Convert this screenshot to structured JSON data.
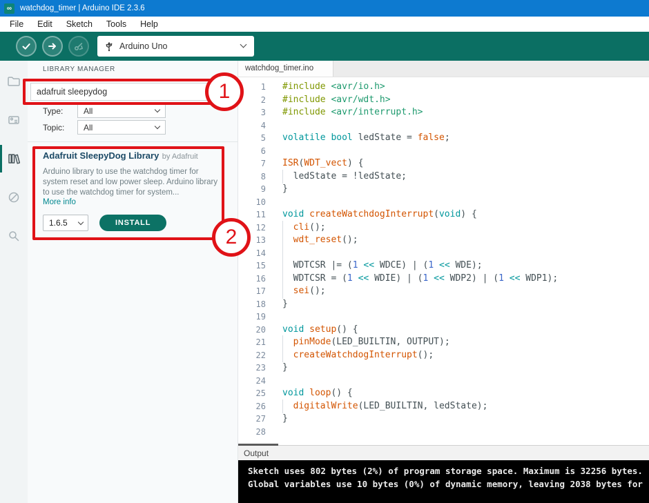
{
  "window": {
    "title": "watchdog_timer | Arduino IDE 2.3.6",
    "app_icon_glyph": "∞"
  },
  "menu": {
    "items": [
      "File",
      "Edit",
      "Sketch",
      "Tools",
      "Help"
    ]
  },
  "toolbar": {
    "buttons": [
      "verify",
      "upload",
      "start-debugging"
    ],
    "board_selected": "Arduino Uno"
  },
  "sidebar": {
    "icons": [
      "folder-sketchbook",
      "boards-manager",
      "library-manager",
      "debug-disabled",
      "search"
    ],
    "active": "library-manager"
  },
  "library_manager": {
    "title": "LIBRARY MANAGER",
    "search_value": "adafruit sleepydog",
    "type_label": "Type:",
    "type_value": "All",
    "topic_label": "Topic:",
    "topic_value": "All",
    "card": {
      "title": "Adafruit SleepyDog Library",
      "by": "by Adafruit",
      "description": "Arduino library to use the watchdog timer for system reset and low power sleep. Arduino library to use the watchdog timer for system...",
      "more_info": "More info",
      "version": "1.6.5",
      "install_label": "INSTALL"
    }
  },
  "annotations": {
    "badge1": "1",
    "badge2": "2",
    "color": "#e01217"
  },
  "editor": {
    "tab": "watchdog_timer.ino",
    "lines": [
      {
        "n": 1,
        "g": false,
        "t": [
          {
            "c": "pre",
            "s": "#include"
          },
          {
            "c": "pl",
            "s": " "
          },
          {
            "c": "inc",
            "s": "<avr/io.h>"
          }
        ]
      },
      {
        "n": 2,
        "g": false,
        "t": [
          {
            "c": "pre",
            "s": "#include"
          },
          {
            "c": "pl",
            "s": " "
          },
          {
            "c": "inc",
            "s": "<avr/wdt.h>"
          }
        ]
      },
      {
        "n": 3,
        "g": false,
        "t": [
          {
            "c": "pre",
            "s": "#include"
          },
          {
            "c": "pl",
            "s": " "
          },
          {
            "c": "inc",
            "s": "<avr/interrupt.h>"
          }
        ]
      },
      {
        "n": 4,
        "g": false,
        "t": []
      },
      {
        "n": 5,
        "g": false,
        "t": [
          {
            "c": "kw",
            "s": "volatile"
          },
          {
            "c": "pl",
            "s": " "
          },
          {
            "c": "kw",
            "s": "bool"
          },
          {
            "c": "pl",
            "s": " ledState = "
          },
          {
            "c": "lit",
            "s": "false"
          },
          {
            "c": "pl",
            "s": ";"
          }
        ]
      },
      {
        "n": 6,
        "g": false,
        "t": []
      },
      {
        "n": 7,
        "g": false,
        "t": [
          {
            "c": "fn",
            "s": "ISR"
          },
          {
            "c": "pl",
            "s": "("
          },
          {
            "c": "fn",
            "s": "WDT_vect"
          },
          {
            "c": "pl",
            "s": ") {"
          }
        ]
      },
      {
        "n": 8,
        "g": true,
        "t": [
          {
            "c": "pl",
            "s": "  ledState = !ledState;"
          }
        ]
      },
      {
        "n": 9,
        "g": false,
        "t": [
          {
            "c": "pl",
            "s": "}"
          }
        ]
      },
      {
        "n": 10,
        "g": false,
        "t": []
      },
      {
        "n": 11,
        "g": false,
        "t": [
          {
            "c": "kw",
            "s": "void"
          },
          {
            "c": "pl",
            "s": " "
          },
          {
            "c": "fn",
            "s": "createWatchdogInterrupt"
          },
          {
            "c": "pl",
            "s": "("
          },
          {
            "c": "kw",
            "s": "void"
          },
          {
            "c": "pl",
            "s": ") {"
          }
        ]
      },
      {
        "n": 12,
        "g": true,
        "t": [
          {
            "c": "pl",
            "s": "  "
          },
          {
            "c": "fn",
            "s": "cli"
          },
          {
            "c": "pl",
            "s": "();"
          }
        ]
      },
      {
        "n": 13,
        "g": true,
        "t": [
          {
            "c": "pl",
            "s": "  "
          },
          {
            "c": "fn",
            "s": "wdt_reset"
          },
          {
            "c": "pl",
            "s": "();"
          }
        ]
      },
      {
        "n": 14,
        "g": true,
        "t": []
      },
      {
        "n": 15,
        "g": true,
        "t": [
          {
            "c": "pl",
            "s": "  WDTCSR |= ("
          },
          {
            "c": "num",
            "s": "1"
          },
          {
            "c": "kw",
            "s": " << "
          },
          {
            "c": "pl",
            "s": "WDCE) | ("
          },
          {
            "c": "num",
            "s": "1"
          },
          {
            "c": "kw",
            "s": " << "
          },
          {
            "c": "pl",
            "s": "WDE);"
          }
        ]
      },
      {
        "n": 16,
        "g": true,
        "t": [
          {
            "c": "pl",
            "s": "  WDTCSR = ("
          },
          {
            "c": "num",
            "s": "1"
          },
          {
            "c": "kw",
            "s": " << "
          },
          {
            "c": "pl",
            "s": "WDIE) | ("
          },
          {
            "c": "num",
            "s": "1"
          },
          {
            "c": "kw",
            "s": " << "
          },
          {
            "c": "pl",
            "s": "WDP2) | ("
          },
          {
            "c": "num",
            "s": "1"
          },
          {
            "c": "kw",
            "s": " << "
          },
          {
            "c": "pl",
            "s": "WDP1);"
          }
        ]
      },
      {
        "n": 17,
        "g": true,
        "t": [
          {
            "c": "pl",
            "s": "  "
          },
          {
            "c": "fn",
            "s": "sei"
          },
          {
            "c": "pl",
            "s": "();"
          }
        ]
      },
      {
        "n": 18,
        "g": false,
        "t": [
          {
            "c": "pl",
            "s": "}"
          }
        ]
      },
      {
        "n": 19,
        "g": false,
        "t": []
      },
      {
        "n": 20,
        "g": false,
        "t": [
          {
            "c": "kw",
            "s": "void"
          },
          {
            "c": "pl",
            "s": " "
          },
          {
            "c": "fn",
            "s": "setup"
          },
          {
            "c": "pl",
            "s": "() {"
          }
        ]
      },
      {
        "n": 21,
        "g": true,
        "t": [
          {
            "c": "pl",
            "s": "  "
          },
          {
            "c": "fn",
            "s": "pinMode"
          },
          {
            "c": "pl",
            "s": "(LED_BUILTIN, OUTPUT);"
          }
        ]
      },
      {
        "n": 22,
        "g": true,
        "t": [
          {
            "c": "pl",
            "s": "  "
          },
          {
            "c": "fn",
            "s": "createWatchdogInterrupt"
          },
          {
            "c": "pl",
            "s": "();"
          }
        ]
      },
      {
        "n": 23,
        "g": false,
        "t": [
          {
            "c": "pl",
            "s": "}"
          }
        ]
      },
      {
        "n": 24,
        "g": false,
        "t": []
      },
      {
        "n": 25,
        "g": false,
        "t": [
          {
            "c": "kw",
            "s": "void"
          },
          {
            "c": "pl",
            "s": " "
          },
          {
            "c": "fn",
            "s": "loop"
          },
          {
            "c": "pl",
            "s": "() {"
          }
        ]
      },
      {
        "n": 26,
        "g": true,
        "t": [
          {
            "c": "pl",
            "s": "  "
          },
          {
            "c": "fn",
            "s": "digitalWrite"
          },
          {
            "c": "pl",
            "s": "(LED_BUILTIN, ledState);"
          }
        ]
      },
      {
        "n": 27,
        "g": false,
        "t": [
          {
            "c": "pl",
            "s": "}"
          }
        ]
      },
      {
        "n": 28,
        "g": false,
        "t": []
      }
    ]
  },
  "output": {
    "tab": "Output",
    "console_lines": [
      "Sketch uses 802 bytes (2%) of program storage space. Maximum is 32256 bytes.",
      "Global variables use 10 bytes (0%) of dynamic memory, leaving 2038 bytes for"
    ]
  },
  "colors": {
    "titlebar": "#0d7ad0",
    "toolbar": "#0b6f63",
    "annotation_red": "#e01217",
    "install_button": "#0c7265",
    "link_teal": "#00878f",
    "console_bg": "#000000"
  }
}
